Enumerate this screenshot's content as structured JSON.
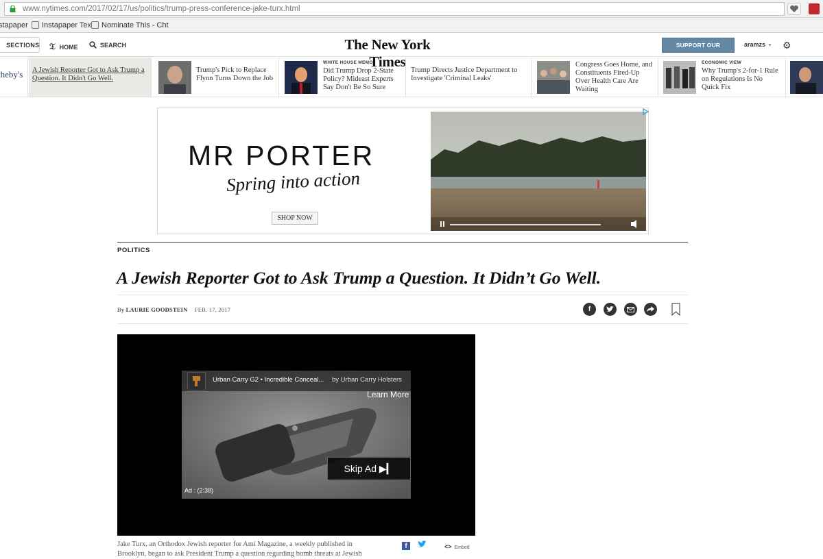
{
  "browser": {
    "url_host": "www.nytimes.com",
    "url_path": "/2017/02/17/us/politics/trump-press-conference-jake-turx.html",
    "bookmarks": [
      "stapaper",
      "Instapaper Text",
      "Nominate This - Cht"
    ]
  },
  "header": {
    "sections_label": "SECTIONS",
    "home_label": "HOME",
    "search_label": "SEARCH",
    "masthead": "The New York Times",
    "support_label": "SUPPORT OUR MISSION",
    "username": "aramzs"
  },
  "ribbon": {
    "partial_sponsor": "theby's",
    "items": [
      {
        "kicker": "",
        "title_line1": "A Jewish Reporter Got to Ask Trump a",
        "title_line2": "Question. It Didn't Go Well."
      },
      {
        "kicker": "",
        "title_line1": "Trump's Pick to Replace",
        "title_line2": "Flynn Turns Down the Job"
      },
      {
        "kicker": "WHITE HOUSE MEMO",
        "title_line1": "Did Trump Drop 2-State",
        "title_line2": "Policy? Mideast Experts",
        "title_line3": "Say Don't Be So Sure"
      },
      {
        "kicker": "",
        "title_line1": "Trump Directs Justice Department to",
        "title_line2": "Investigate 'Criminal Leaks'"
      },
      {
        "kicker": "",
        "title_line1": "Congress Goes Home, and",
        "title_line2": "Constituents Fired-Up",
        "title_line3": "Over Health Care Are",
        "title_line4": "Waiting"
      },
      {
        "kicker": "ECONOMIC VIEW",
        "title_line1": "Why Trump's 2-for-1 Rule",
        "title_line2": "on Regulations Is No",
        "title_line3": "Quick Fix"
      }
    ]
  },
  "ad": {
    "brand": "MR PORTER",
    "tagline": "Spring into action",
    "cta": "SHOP NOW"
  },
  "article": {
    "section": "POLITICS",
    "headline": "A Jewish Reporter Got to Ask Trump a Question. It Didn’t Go Well.",
    "byline_prefix": "By",
    "author": "LAURIE GOODSTEIN",
    "date": "FEB. 17, 2017"
  },
  "video": {
    "ad_title": "Urban Carry G2 • Incredible Conceal...",
    "ad_by": "by Urban Carry Holsters",
    "learn_more": "Learn More",
    "skip_ad": "Skip Ad ▶▎",
    "ad_timer": "Ad : (2:38)",
    "caption_line1": "Jake Turx, an Orthodox Jewish reporter for Ami Magazine, a weekly published in",
    "caption_line2": "Brooklyn, began to ask President Trump a question regarding bomb threats at Jewish",
    "embed_label": "Embed"
  },
  "colors": {
    "support_button": "#6288a5",
    "ribbon_active": "#e9e9e5",
    "share_icon": "#333333"
  }
}
